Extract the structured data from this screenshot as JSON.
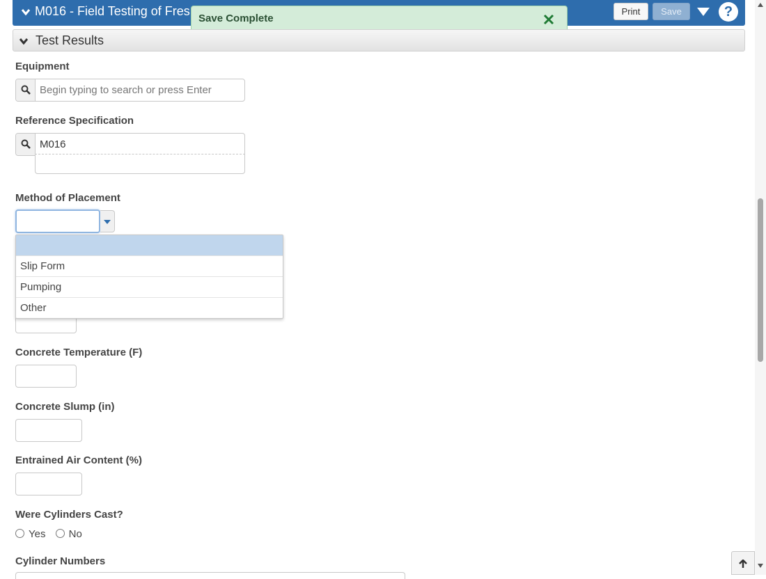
{
  "header": {
    "title": "M016 - Field Testing of Fres",
    "print_label": "Print",
    "save_label": "Save"
  },
  "toast": {
    "message": "Save Complete"
  },
  "section": {
    "title": "Test Results"
  },
  "fields": {
    "equipment": {
      "label": "Equipment",
      "placeholder": "Begin typing to search or press Enter",
      "value": ""
    },
    "reference_specification": {
      "label": "Reference Specification",
      "value": "M016"
    },
    "method_of_placement": {
      "label": "Method of Placement",
      "value": "",
      "options": [
        "",
        "Slip Form",
        "Pumping",
        "Other"
      ]
    },
    "concrete_temperature": {
      "label": "Concrete Temperature (F)",
      "value": ""
    },
    "concrete_slump": {
      "label": "Concrete Slump (in)",
      "value": ""
    },
    "entrained_air_content": {
      "label": "Entrained Air Content (%)",
      "value": ""
    },
    "cylinders_cast": {
      "label": "Were Cylinders Cast?",
      "yes_label": "Yes",
      "no_label": "No"
    },
    "cylinder_numbers": {
      "label": "Cylinder Numbers"
    }
  },
  "colors": {
    "header_bg": "#2e6dad",
    "toast_bg": "#d4ecd9",
    "selected_option_bg": "#c0d6ed"
  },
  "icons": [
    "chevron-down-icon",
    "close-icon",
    "caret-down-icon",
    "help-icon",
    "search-icon",
    "arrow-up-icon"
  ]
}
